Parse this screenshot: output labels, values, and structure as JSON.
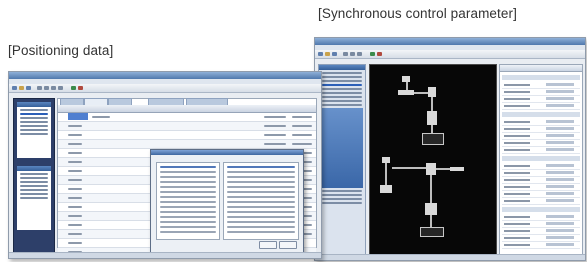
{
  "captions": {
    "positioning": "[Positioning data]",
    "synchronous": "[Synchronous control parameter]"
  },
  "colors": {
    "title_bar": "#4f78ad",
    "dialog_title": "#3f679f",
    "canvas_background": "#070707",
    "nav_dark": "#2d3f69"
  }
}
